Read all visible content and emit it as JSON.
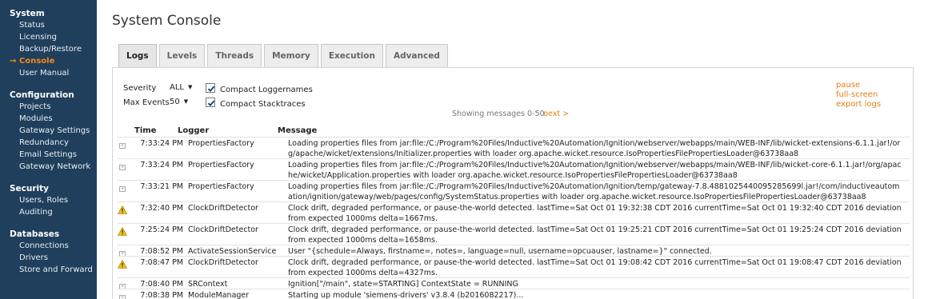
{
  "sidebar": {
    "sections": [
      {
        "title": "System",
        "items": [
          "Status",
          "Licensing",
          "Backup/Restore",
          "Console",
          "User Manual"
        ]
      },
      {
        "title": "Configuration",
        "items": [
          "Projects",
          "Modules",
          "Gateway Settings",
          "Redundancy",
          "Email Settings",
          "Gateway Network"
        ]
      },
      {
        "title": "Security",
        "items": [
          "Users, Roles",
          "Auditing"
        ]
      },
      {
        "title": "Databases",
        "items": [
          "Connections",
          "Drivers",
          "Store and Forward"
        ]
      }
    ],
    "active_item": "Console",
    "arrow": "→"
  },
  "page_title": "System Console",
  "tabs": [
    {
      "label": "Logs",
      "active": true
    },
    {
      "label": "Levels"
    },
    {
      "label": "Threads"
    },
    {
      "label": "Memory"
    },
    {
      "label": "Execution"
    },
    {
      "label": "Advanced"
    }
  ],
  "controls": {
    "severity_label": "Severity",
    "severity_value": "ALL",
    "max_events_label": "Max Events",
    "max_events_value": "50",
    "compact_loggernames_label": "Compact Loggernames",
    "compact_loggernames_checked": true,
    "compact_stacktraces_label": "Compact Stacktraces",
    "compact_stacktraces_checked": true,
    "pause_link": "pause",
    "fullscreen_link": "full-screen",
    "export_link": "export logs",
    "showing_text": "Showing messages 0-50.",
    "next_link": "next >"
  },
  "log_table": {
    "headers": {
      "time": "Time",
      "logger": "Logger",
      "message": "Message"
    },
    "rows": [
      {
        "level": "info",
        "time": "7:33:24 PM",
        "logger": "PropertiesFactory",
        "message": "Loading properties files from jar:file:/C:/Program%20Files/Inductive%20Automation/Ignition/webserver/webapps/main/WEB-INF/lib/wicket-extensions-6.1.1.jar!/org/apache/wicket/extensions/Initializer.properties with loader org.apache.wicket.resource.IsoPropertiesFilePropertiesLoader@63738aa8"
      },
      {
        "level": "info",
        "time": "7:33:24 PM",
        "logger": "PropertiesFactory",
        "message": "Loading properties files from jar:file:/C:/Program%20Files/Inductive%20Automation/Ignition/webserver/webapps/main/WEB-INF/lib/wicket-core-6.1.1.jar!/org/apache/wicket/Application.properties with loader org.apache.wicket.resource.IsoPropertiesFilePropertiesLoader@63738aa8"
      },
      {
        "level": "info",
        "time": "7:33:21 PM",
        "logger": "PropertiesFactory",
        "message": "Loading properties files from jar:file:/C:/Program%20Files/Inductive%20Automation/Ignition/temp/gateway-7.8.4881025440095285699l.jar!/com/inductiveautomation/ignition/gateway/web/pages/config/SystemStatus.properties with loader org.apache.wicket.resource.IsoPropertiesFilePropertiesLoader@63738aa8"
      },
      {
        "level": "warn",
        "time": "7:32:40 PM",
        "logger": "ClockDriftDetector",
        "message": "Clock drift, degraded performance, or pause-the-world detected. lastTime=Sat Oct 01 19:32:38 CDT 2016 currentTime=Sat Oct 01 19:32:40 CDT 2016 deviation from expected 1000ms delta=1667ms."
      },
      {
        "level": "warn",
        "time": "7:25:24 PM",
        "logger": "ClockDriftDetector",
        "message": "Clock drift, degraded performance, or pause-the-world detected. lastTime=Sat Oct 01 19:25:21 CDT 2016 currentTime=Sat Oct 01 19:25:24 CDT 2016 deviation from expected 1000ms delta=1658ms."
      },
      {
        "level": "info",
        "time": "7:08:52 PM",
        "logger": "ActivateSessionService",
        "message": "User \"{schedule=Always, firstname=, notes=, language=null, username=opcuauser, lastname=}\" connected."
      },
      {
        "level": "warn",
        "time": "7:08:47 PM",
        "logger": "ClockDriftDetector",
        "message": "Clock drift, degraded performance, or pause-the-world detected. lastTime=Sat Oct 01 19:08:42 CDT 2016 currentTime=Sat Oct 01 19:08:47 CDT 2016 deviation from expected 1000ms delta=4327ms."
      },
      {
        "level": "info",
        "time": "7:08:40 PM",
        "logger": "SRContext",
        "message": "Ignition[\"/main\", state=STARTING] ContextState = RUNNING"
      },
      {
        "level": "info",
        "time": "7:08:38 PM",
        "logger": "ModuleManager",
        "message": "Starting up module 'siemens-drivers' v3.8.4 (b2016082217)..."
      }
    ]
  },
  "colors": {
    "sidebar_bg": "#1f3f5c",
    "accent": "#e87e14",
    "warn_icon": "#f2c21b"
  }
}
